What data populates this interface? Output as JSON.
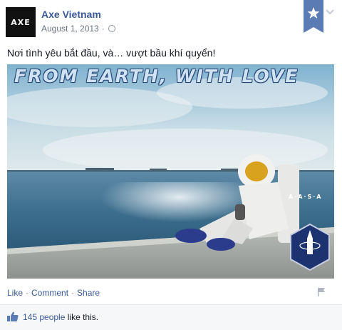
{
  "post": {
    "page_name": "Axe Vietnam",
    "avatar_text": "AXE",
    "date": "August 1, 2013",
    "separator": "·",
    "text": "Nơi tình yêu bắt đầu, và… vượt bầu khí quyển!",
    "photo": {
      "caption": "FROM EARTH, WITH LOVE",
      "badge_text": "A·A·S·A"
    },
    "actions": {
      "like": "Like",
      "comment": "Comment",
      "share": "Share",
      "dot": "·"
    },
    "likes": {
      "count_text": "145 people",
      "suffix": "like this."
    }
  },
  "icons": [
    "globe-icon",
    "star-icon",
    "chevron-down-icon",
    "flag-icon",
    "thumbs-up-icon"
  ],
  "colors": {
    "link": "#3b5998",
    "ribbon": "#5b7bb4",
    "meta_text": "#6a7180"
  }
}
